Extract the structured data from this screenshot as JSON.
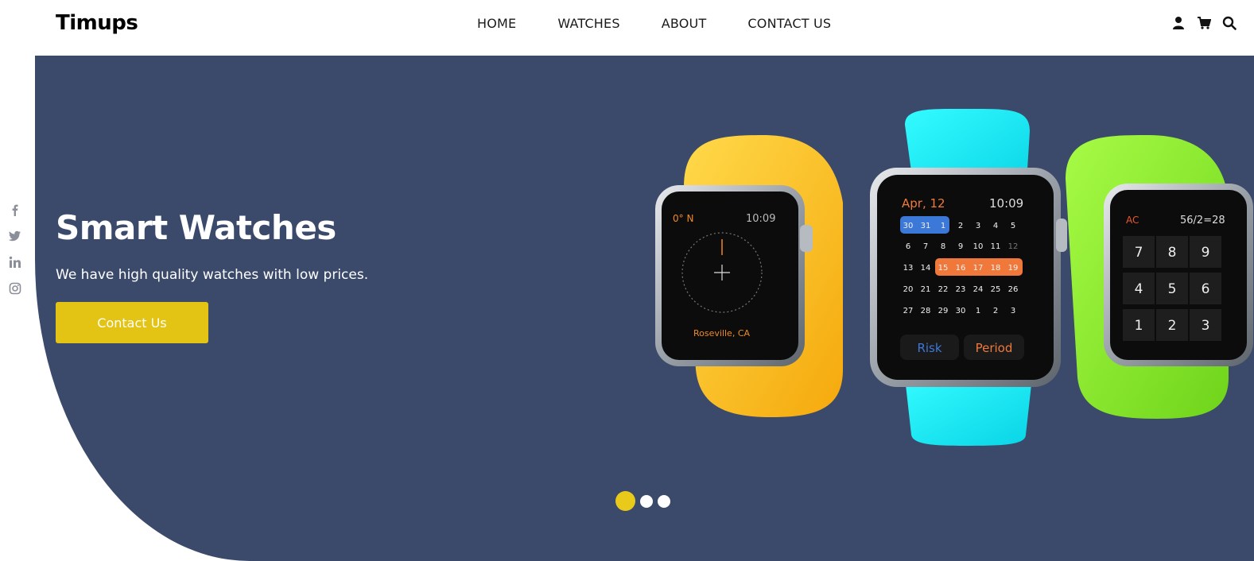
{
  "header": {
    "logo": "Timups",
    "nav": [
      "HOME",
      "WATCHES",
      "ABOUT",
      "CONTACT US"
    ],
    "icons": [
      "user-icon",
      "cart-icon",
      "search-icon"
    ]
  },
  "social": [
    "facebook-icon",
    "twitter-icon",
    "linkedin-icon",
    "instagram-icon"
  ],
  "hero": {
    "title": "Smart Watches",
    "subtitle": "We have high quality watches with low prices.",
    "cta_label": "Contact Us",
    "slides": 3,
    "active_slide": 1
  },
  "watch_screens": {
    "compass": {
      "heading": "0° N",
      "time": "10:09",
      "location": "Roseville, CA"
    },
    "calendar": {
      "date": "Apr, 12",
      "time": "10:09",
      "rows": [
        [
          "30",
          "31",
          "1",
          "2",
          "3",
          "4",
          "5"
        ],
        [
          "6",
          "7",
          "8",
          "9",
          "10",
          "11",
          "12"
        ],
        [
          "13",
          "14",
          "15",
          "16",
          "17",
          "18",
          "19"
        ],
        [
          "20",
          "21",
          "22",
          "23",
          "24",
          "25",
          "26"
        ],
        [
          "27",
          "28",
          "29",
          "30",
          "1",
          "2",
          "3"
        ]
      ],
      "buttons": [
        "Risk",
        "Period"
      ]
    },
    "calculator": {
      "clear": "AC",
      "display": "56/2=28",
      "keys": [
        "7",
        "8",
        "9",
        "4",
        "5",
        "6",
        "1",
        "2",
        "3"
      ]
    }
  },
  "colors": {
    "hero_bg": "#3b4a6b",
    "accent": "#e3c313",
    "dot_active": "#e9c91a",
    "band_yellow": "#ffc21a",
    "band_cyan": "#15f0f5",
    "band_green": "#8ef12a"
  }
}
